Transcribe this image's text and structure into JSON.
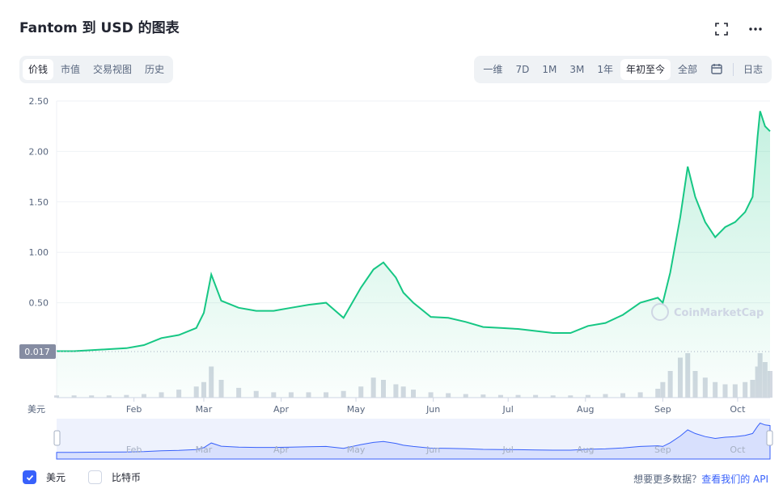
{
  "header": {
    "title": "Fantom 到 USD 的图表",
    "fullscreen_icon": "fullscreen-icon",
    "more_icon": "more-icon"
  },
  "view_tabs": [
    "价钱",
    "市值",
    "交易视图",
    "历史"
  ],
  "view_tabs_active": "价钱",
  "range_tabs": [
    "一维",
    "7D",
    "1M",
    "3M",
    "1年",
    "年初至今",
    "全部"
  ],
  "range_tabs_active": "年初至今",
  "calendar_icon": "calendar-icon",
  "log_label": "日志",
  "watermark": "CoinMarketCap",
  "currency_axis_label": "美元",
  "open_price_label": "0.017",
  "colors": {
    "line": "#16c784",
    "fill": "#16c784",
    "volume": "#c8ced8",
    "navigator": "#3861fb"
  },
  "footer": {
    "checkbox_usd": "美元",
    "checkbox_btc": "比特币",
    "api_text": "想要更多数据？",
    "api_link": "查看我们的 API"
  },
  "chart_data": {
    "type": "area",
    "series": [
      {
        "x": [
          "2021-01-01",
          "2021-01-08",
          "2021-01-15",
          "2021-01-22",
          "2021-01-29",
          "2021-02-05",
          "2021-02-12",
          "2021-02-19",
          "2021-02-26",
          "2021-03-01",
          "2021-03-04",
          "2021-03-08",
          "2021-03-15",
          "2021-03-22",
          "2021-03-29",
          "2021-04-05",
          "2021-04-12",
          "2021-04-19",
          "2021-04-26",
          "2021-05-03",
          "2021-05-08",
          "2021-05-12",
          "2021-05-17",
          "2021-05-20",
          "2021-05-24",
          "2021-05-31",
          "2021-06-07",
          "2021-06-14",
          "2021-06-21",
          "2021-06-28",
          "2021-07-05",
          "2021-07-12",
          "2021-07-19",
          "2021-07-26",
          "2021-08-02",
          "2021-08-09",
          "2021-08-16",
          "2021-08-23",
          "2021-08-30",
          "2021-09-01",
          "2021-09-04",
          "2021-09-08",
          "2021-09-11",
          "2021-09-14",
          "2021-09-18",
          "2021-09-22",
          "2021-09-26",
          "2021-09-30",
          "2021-10-04",
          "2021-10-07",
          "2021-10-09",
          "2021-10-10",
          "2021-10-12",
          "2021-10-14"
        ],
        "y": [
          0.02,
          0.02,
          0.03,
          0.04,
          0.05,
          0.08,
          0.15,
          0.18,
          0.25,
          0.4,
          0.78,
          0.52,
          0.45,
          0.42,
          0.42,
          0.45,
          0.48,
          0.5,
          0.35,
          0.65,
          0.83,
          0.9,
          0.75,
          0.6,
          0.5,
          0.36,
          0.35,
          0.31,
          0.26,
          0.25,
          0.24,
          0.22,
          0.2,
          0.2,
          0.27,
          0.3,
          0.38,
          0.5,
          0.55,
          0.5,
          0.8,
          1.35,
          1.85,
          1.55,
          1.3,
          1.15,
          1.25,
          1.3,
          1.4,
          1.55,
          2.15,
          2.4,
          2.25,
          2.2
        ]
      }
    ],
    "ylim": [
      0,
      2.5
    ],
    "yticks": [
      "0.50",
      "1.00",
      "1.50",
      "2.00",
      "2.50"
    ],
    "xticks": [
      "Feb",
      "Mar",
      "Apr",
      "May",
      "Jun",
      "Jul",
      "Aug",
      "Sep",
      "Oct"
    ],
    "volume": [
      0.05,
      0.05,
      0.05,
      0.05,
      0.06,
      0.08,
      0.12,
      0.18,
      0.25,
      0.35,
      0.7,
      0.4,
      0.22,
      0.15,
      0.12,
      0.12,
      0.12,
      0.12,
      0.15,
      0.25,
      0.45,
      0.4,
      0.3,
      0.25,
      0.18,
      0.12,
      0.1,
      0.08,
      0.07,
      0.06,
      0.06,
      0.06,
      0.05,
      0.05,
      0.06,
      0.08,
      0.1,
      0.12,
      0.2,
      0.35,
      0.6,
      0.9,
      1.0,
      0.6,
      0.45,
      0.35,
      0.3,
      0.3,
      0.35,
      0.4,
      0.7,
      1.0,
      0.8,
      0.6
    ],
    "grid": true
  }
}
